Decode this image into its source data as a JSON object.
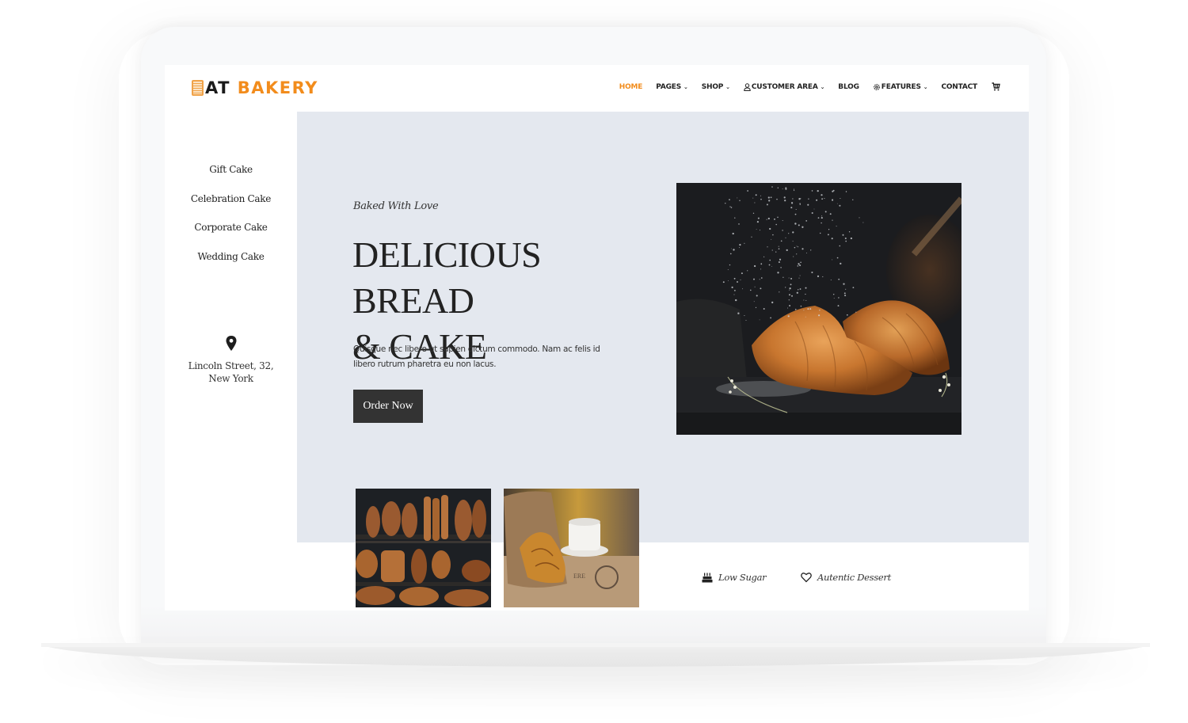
{
  "brand": {
    "logo_part1": "AT",
    "logo_part2": "BAKERY",
    "accent_color": "#f28c1c"
  },
  "nav": {
    "items": [
      {
        "label": "HOME",
        "active": true,
        "dropdown": false
      },
      {
        "label": "PAGES",
        "active": false,
        "dropdown": true
      },
      {
        "label": "SHOP",
        "active": false,
        "dropdown": true
      },
      {
        "label": "CUSTOMER AREA",
        "active": false,
        "dropdown": true,
        "icon": "user-icon"
      },
      {
        "label": "BLOG",
        "active": false,
        "dropdown": false
      },
      {
        "label": "FEATURES",
        "active": false,
        "dropdown": true,
        "icon": "gear-icon"
      },
      {
        "label": "CONTACT",
        "active": false,
        "dropdown": false
      }
    ],
    "cart_icon": "cart-icon"
  },
  "sidebar": {
    "links": [
      "Gift Cake",
      "Celebration Cake",
      "Corporate Cake",
      "Wedding Cake"
    ],
    "location_icon": "map-pin-icon",
    "address": "Lincoln Street, 32, New York"
  },
  "hero": {
    "tagline": "Baked With Love",
    "title_line1": "DELICIOUS BREAD",
    "title_line2": "& CAKE",
    "description": "Quisque nec libero ut sapien dictum commodo. Nam ac felis id libero rutrum pharetra eu non lacus.",
    "button_label": "Order Now",
    "image_alt": "Croissants dusted with powdered sugar",
    "background_color": "#e4e8ef"
  },
  "gallery": [
    {
      "alt": "Bread loaves on bakery shelves"
    },
    {
      "alt": "Croissant in paper bag with coffee cup"
    }
  ],
  "features": [
    {
      "icon": "cake-icon",
      "label": "Low Sugar"
    },
    {
      "icon": "heart-icon",
      "label": "Autentic Dessert"
    }
  ]
}
